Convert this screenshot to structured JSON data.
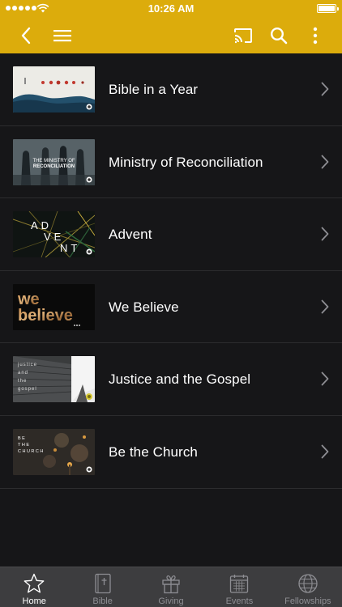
{
  "status_bar": {
    "time": "10:26 AM"
  },
  "header": {
    "icons": [
      "back-chevron-icon",
      "menu-icon",
      "cast-icon",
      "search-icon",
      "more-vertical-icon"
    ]
  },
  "colors": {
    "accent": "#dcac0c",
    "background": "#161618",
    "tabbar": "#3d3d3f"
  },
  "series": [
    {
      "title": "Bible in a Year"
    },
    {
      "title": "Ministry of Reconciliation",
      "thumb_text": [
        "THE MINISTRY OF",
        "RECONCILIATION"
      ]
    },
    {
      "title": "Advent",
      "thumb_text": [
        "AD",
        "VE",
        "NT"
      ]
    },
    {
      "title": "We Believe",
      "thumb_text": [
        "we",
        "believe"
      ]
    },
    {
      "title": "Justice and the Gospel",
      "thumb_text": [
        "justice",
        "and",
        "the",
        "gospel"
      ]
    },
    {
      "title": "Be the Church",
      "thumb_text": [
        "BE",
        "THE",
        "CHURCH"
      ]
    }
  ],
  "tabbar": {
    "tabs": [
      {
        "label": "Home",
        "icon": "star-icon",
        "active": true
      },
      {
        "label": "Bible",
        "icon": "bible-icon",
        "active": false
      },
      {
        "label": "Giving",
        "icon": "gift-icon",
        "active": false
      },
      {
        "label": "Events",
        "icon": "calendar-icon",
        "active": false
      },
      {
        "label": "Fellowships",
        "icon": "globe-icon",
        "active": false
      }
    ]
  }
}
